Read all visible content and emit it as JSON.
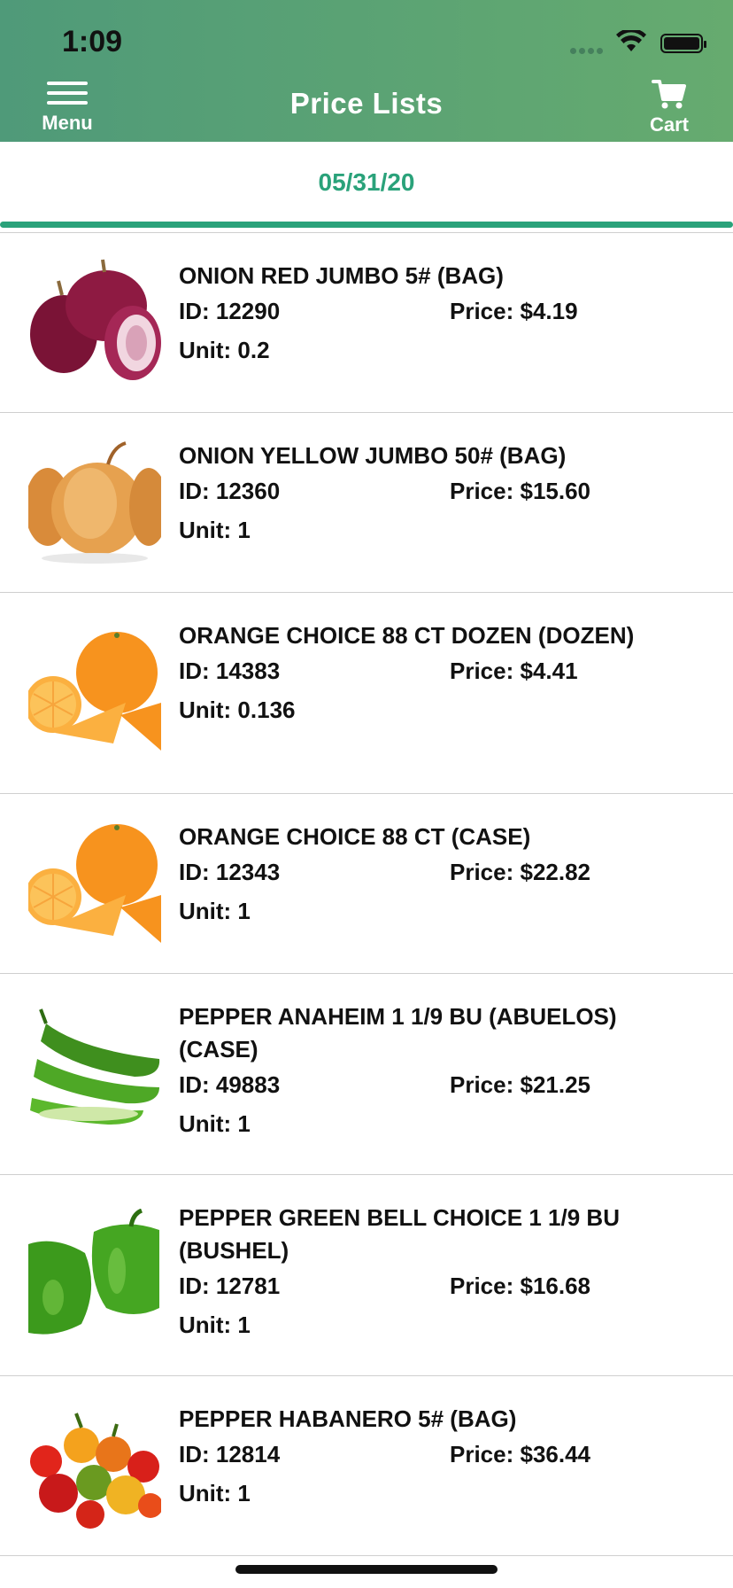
{
  "status": {
    "time": "1:09"
  },
  "header": {
    "menu_label": "Menu",
    "title": "Price Lists",
    "cart_label": "Cart"
  },
  "date": "05/31/20",
  "colors": {
    "header_start": "#4f9a79",
    "header_end": "#66ab6f",
    "accent": "#2aa27a"
  },
  "items": [
    {
      "name": "ONION RED JUMBO 5# (BAG)",
      "id": "ID: 12290",
      "price": "Price: $4.19",
      "unit": "Unit: 0.2",
      "image": "red-onion"
    },
    {
      "name": "ONION YELLOW JUMBO 50# (BAG)",
      "id": "ID: 12360",
      "price": "Price: $15.60",
      "unit": "Unit: 1",
      "image": "yellow-onion"
    },
    {
      "name": "ORANGE CHOICE 88  CT DOZEN (DOZEN)",
      "id": "ID: 14383",
      "price": "Price: $4.41",
      "unit": "Unit: 0.136",
      "image": "orange"
    },
    {
      "name": "ORANGE CHOICE 88 CT (CASE)",
      "id": "ID: 12343",
      "price": "Price: $22.82",
      "unit": "Unit: 1",
      "image": "orange"
    },
    {
      "name": "PEPPER ANAHEIM 1 1/9 BU (ABUELOS) (CASE)",
      "id": "ID: 49883",
      "price": "Price: $21.25",
      "unit": "Unit: 1",
      "image": "anaheim-pepper"
    },
    {
      "name": "PEPPER GREEN BELL CHOICE  1 1/9 BU (BUSHEL)",
      "id": "ID: 12781",
      "price": "Price: $16.68",
      "unit": "Unit: 1",
      "image": "green-bell-pepper"
    },
    {
      "name": "PEPPER HABANERO 5# (BAG)",
      "id": "ID: 12814",
      "price": "Price: $36.44",
      "unit": "Unit: 1",
      "image": "habanero-pepper"
    }
  ]
}
